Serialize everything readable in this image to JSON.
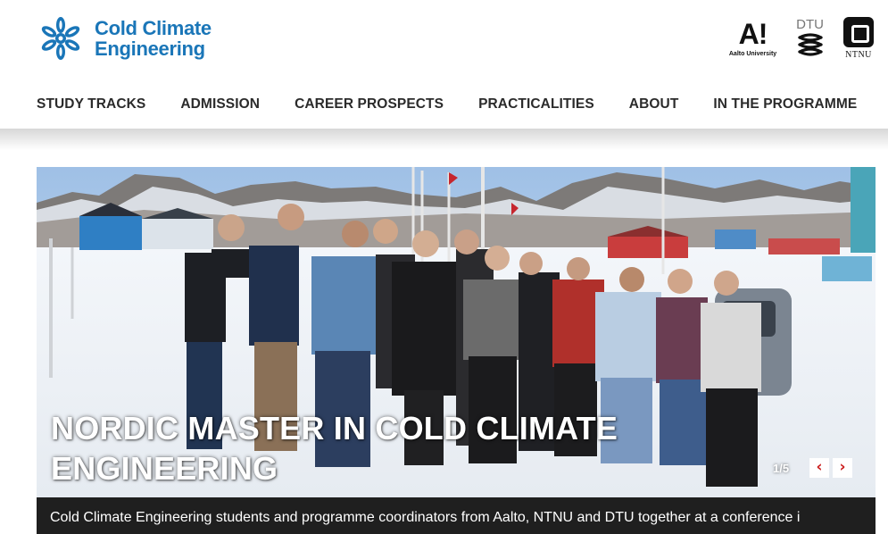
{
  "header": {
    "logo_line1": "Cold Climate",
    "logo_line2": "Engineering",
    "partners": [
      {
        "name": "A!",
        "sub": "Aalto University",
        "icon": "aalto-logo"
      },
      {
        "name": "DTU",
        "icon": "dtu-logo"
      },
      {
        "name": "NTNU",
        "icon": "ntnu-logo"
      }
    ]
  },
  "nav": {
    "items": [
      {
        "label": "STUDY TRACKS"
      },
      {
        "label": "ADMISSION"
      },
      {
        "label": "CAREER PROSPECTS"
      },
      {
        "label": "PRACTICALITIES"
      },
      {
        "label": "ABOUT"
      },
      {
        "label": "IN THE PROGRAMME"
      }
    ]
  },
  "slider": {
    "title": "NORDIC MASTER IN COLD CLIMATE ENGINEERING",
    "counter": "1/5",
    "prev_icon": "chevron-left-icon",
    "next_icon": "chevron-right-icon",
    "caption": "Cold Climate Engineering students and programme coordinators from Aalto, NTNU and DTU together at a conference i"
  },
  "colors": {
    "brand_blue": "#1a76b8",
    "nav_text": "#2b2b2b",
    "arrow_red": "#cc1f1f",
    "caption_bg": "#1f1f1f"
  }
}
